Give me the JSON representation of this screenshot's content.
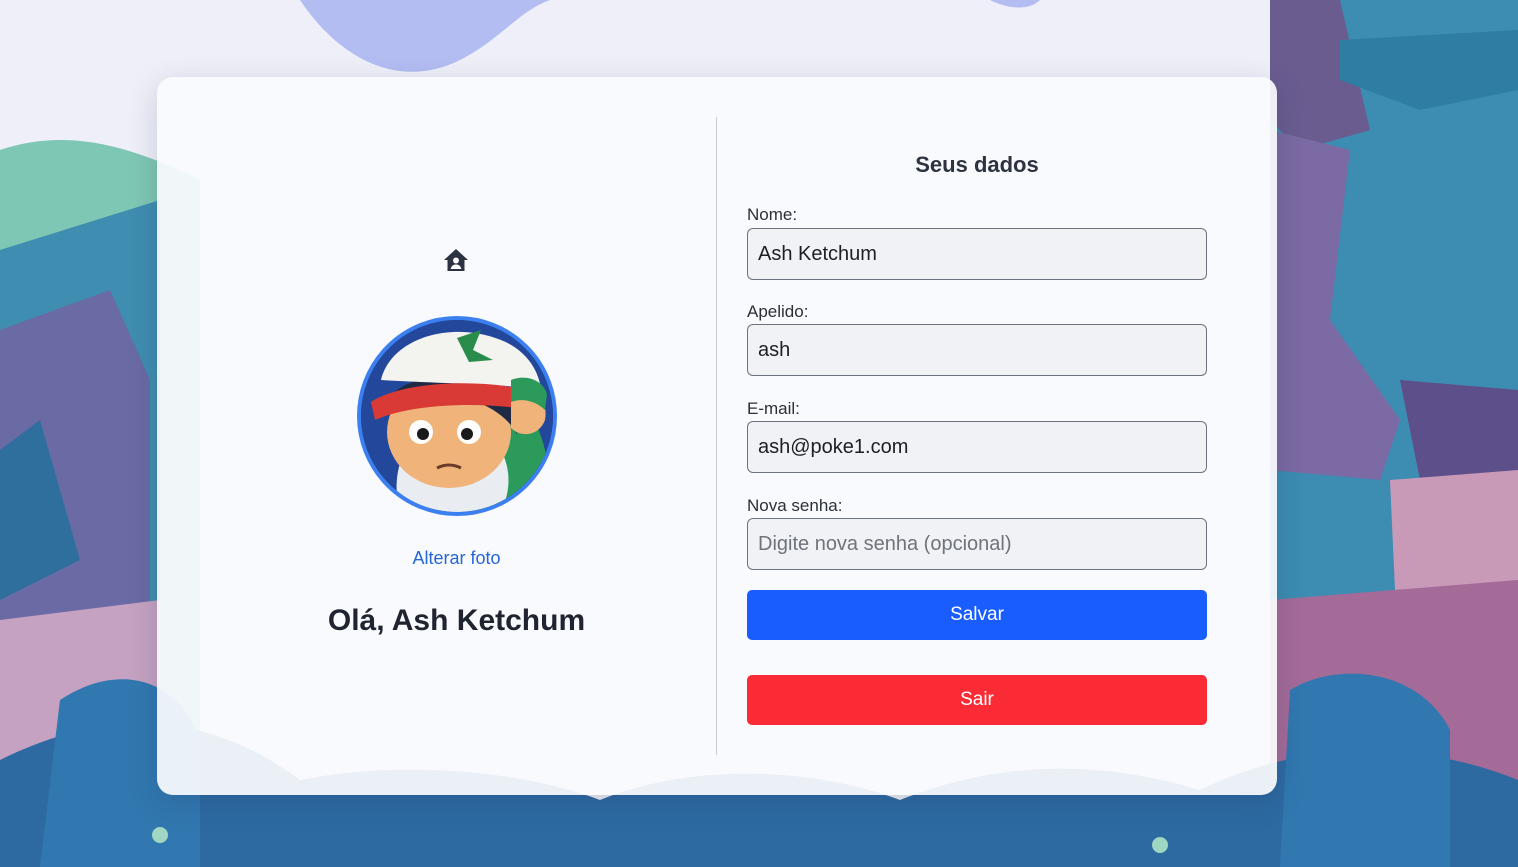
{
  "profile": {
    "change_photo_label": "Alterar foto",
    "greeting": "Olá, Ash Ketchum"
  },
  "form": {
    "title": "Seus dados",
    "name_label": "Nome:",
    "name_value": "Ash Ketchum",
    "nickname_label": "Apelido:",
    "nickname_value": "ash",
    "email_label": "E-mail:",
    "email_value": "ash@poke1.com",
    "password_label": "Nova senha:",
    "password_placeholder": "Digite nova senha (opcional)",
    "save_label": "Salvar",
    "exit_label": "Sair"
  },
  "icons": {
    "home": "home-user-icon",
    "avatar": "ash-ketchum-avatar"
  },
  "colors": {
    "save_button": "#1a5dff",
    "exit_button": "#fb2b36",
    "link": "#2566d8",
    "avatar_border": "#3b7ff0"
  }
}
